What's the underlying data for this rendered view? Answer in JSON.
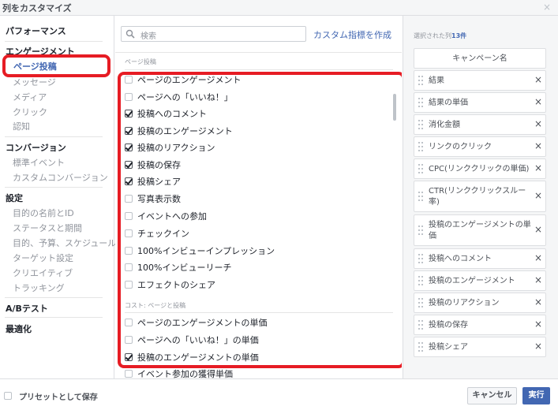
{
  "window": {
    "title": "列をカスタマイズ",
    "close_glyph": "×"
  },
  "sidebar": {
    "sections": [
      {
        "heading": "パフォーマンス",
        "items": []
      },
      {
        "heading": "エンゲージメント",
        "items": [
          "ページ投稿",
          "メッセージ",
          "メディア",
          "クリック",
          "認知"
        ]
      },
      {
        "heading": "コンバージョン",
        "items": [
          "標準イベント",
          "カスタムコンバージョン"
        ]
      },
      {
        "heading": "設定",
        "items": [
          "目的の名前とID",
          "ステータスと期間",
          "目的、予算、スケジュール",
          "ターゲット設定",
          "クリエイティブ",
          "トラッキング"
        ]
      },
      {
        "heading": "A/Bテスト",
        "items": []
      },
      {
        "heading": "最適化",
        "items": []
      }
    ],
    "active_item": "ページ投稿"
  },
  "search": {
    "placeholder": "検索",
    "icon": "search-icon"
  },
  "custom_metric_link": "カスタム指標を作成",
  "list": {
    "section1_label": "ページ投稿",
    "section1_items": [
      {
        "label": "ページのエンゲージメント",
        "checked": false
      },
      {
        "label": "ページへの「いいね！」",
        "checked": false
      },
      {
        "label": "投稿へのコメント",
        "checked": true
      },
      {
        "label": "投稿のエンゲージメント",
        "checked": true
      },
      {
        "label": "投稿のリアクション",
        "checked": true
      },
      {
        "label": "投稿の保存",
        "checked": true
      },
      {
        "label": "投稿シェア",
        "checked": true
      },
      {
        "label": "写真表示数",
        "checked": false
      },
      {
        "label": "イベントへの参加",
        "checked": false
      },
      {
        "label": "チェックイン",
        "checked": false
      },
      {
        "label": "100%インビューインプレッション",
        "checked": false
      },
      {
        "label": "100%インビューリーチ",
        "checked": false
      },
      {
        "label": "エフェクトのシェア",
        "checked": false
      }
    ],
    "section2_label": "コスト: ページと投稿",
    "section2_items": [
      {
        "label": "ページのエンゲージメントの単価",
        "checked": false
      },
      {
        "label": "ページへの「いいね！」の単価",
        "checked": false
      },
      {
        "label": "投稿のエンゲージメントの単価",
        "checked": true
      },
      {
        "label": "イベント参加の獲得単価",
        "checked": false
      }
    ]
  },
  "selected": {
    "heading_prefix": "選択された列",
    "count": "13件",
    "fixed_item": "キャンペーン名",
    "items": [
      "結果",
      "結果の単価",
      "消化金額",
      "リンクのクリック",
      "CPC(リンククリックの単価)",
      "CTR(リンククリックスルー率)",
      "投稿のエンゲージメントの単価",
      "投稿へのコメント",
      "投稿のエンゲージメント",
      "投稿のリアクション",
      "投稿の保存",
      "投稿シェア"
    ],
    "remove_glyph": "×"
  },
  "footer": {
    "preset_label": "プリセットとして保存",
    "cancel_label": "キャンセル",
    "run_label": "実行"
  },
  "colors": {
    "accent": "#4267b2",
    "annotation_red": "#e61c24"
  }
}
